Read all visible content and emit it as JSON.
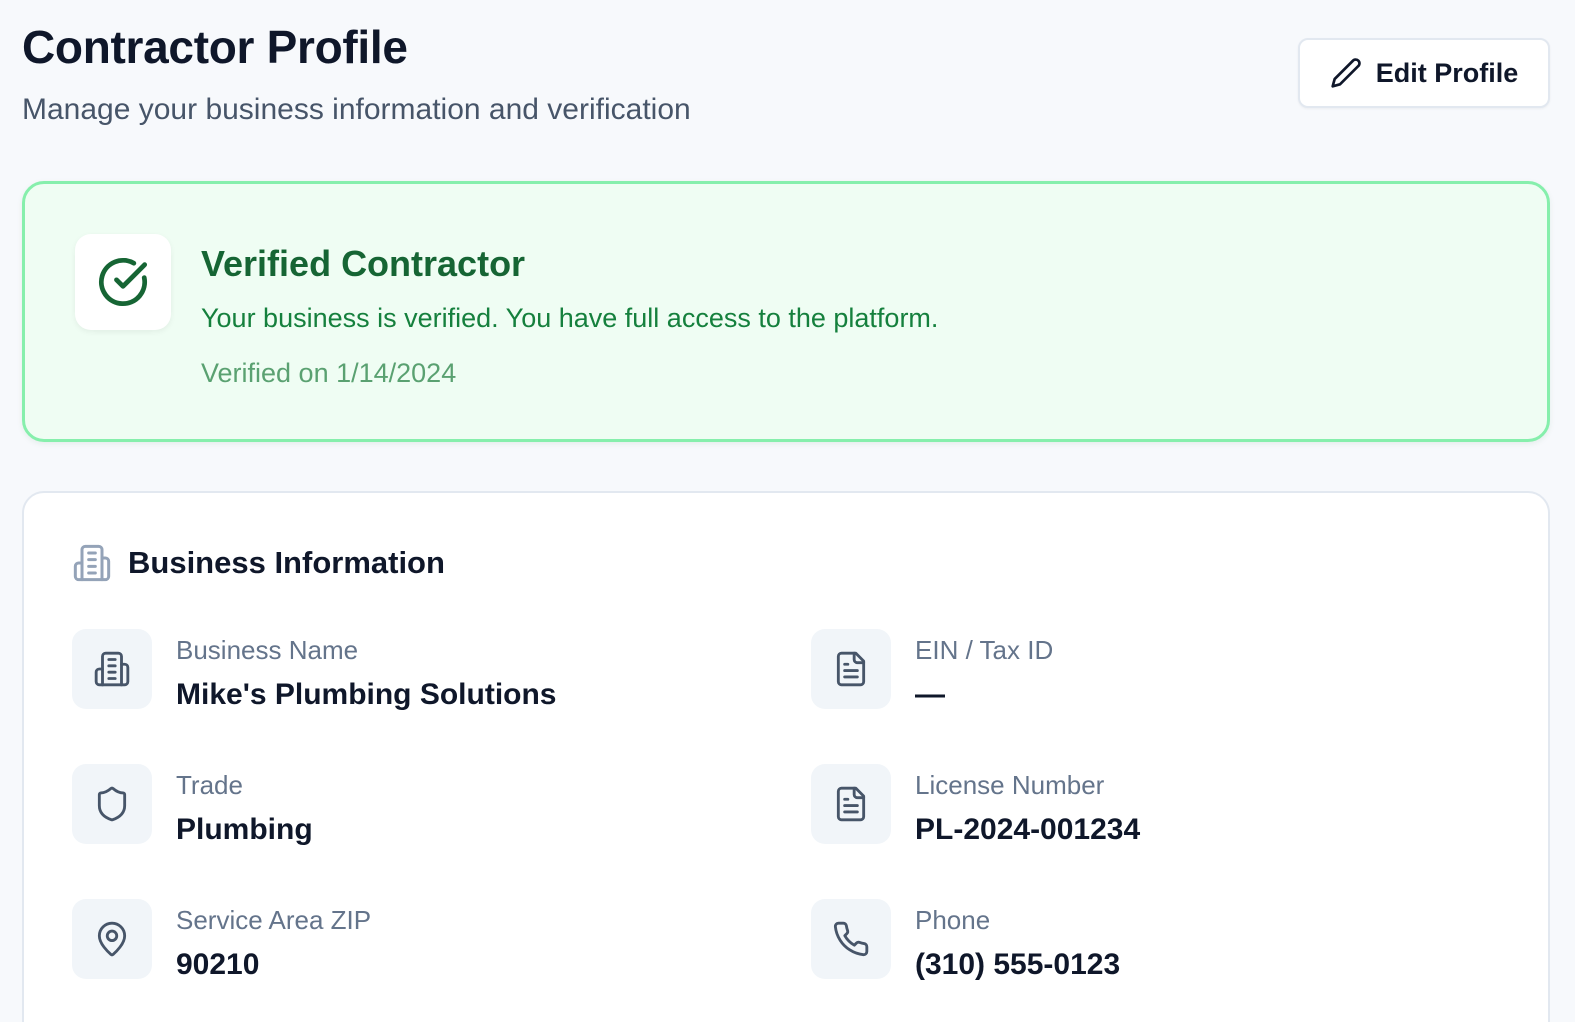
{
  "header": {
    "title": "Contractor Profile",
    "subtitle": "Manage your business information and verification",
    "edit_label": "Edit Profile"
  },
  "verification": {
    "title": "Verified Contractor",
    "description": "Your business is verified. You have full access to the platform.",
    "date": "Verified on 1/14/2024",
    "colors": {
      "accent": "#166534",
      "background": "#effdf3",
      "border": "#86efac"
    }
  },
  "business": {
    "section_title": "Business Information",
    "fields": [
      {
        "icon": "building-icon",
        "label": "Business Name",
        "value": "Mike's Plumbing Solutions"
      },
      {
        "icon": "document-icon",
        "label": "EIN / Tax ID",
        "value": "—"
      },
      {
        "icon": "shield-icon",
        "label": "Trade",
        "value": "Plumbing"
      },
      {
        "icon": "document-icon",
        "label": "License Number",
        "value": "PL-2024-001234"
      },
      {
        "icon": "map-pin-icon",
        "label": "Service Area ZIP",
        "value": "90210"
      },
      {
        "icon": "phone-icon",
        "label": "Phone",
        "value": "(310) 555-0123"
      }
    ]
  }
}
